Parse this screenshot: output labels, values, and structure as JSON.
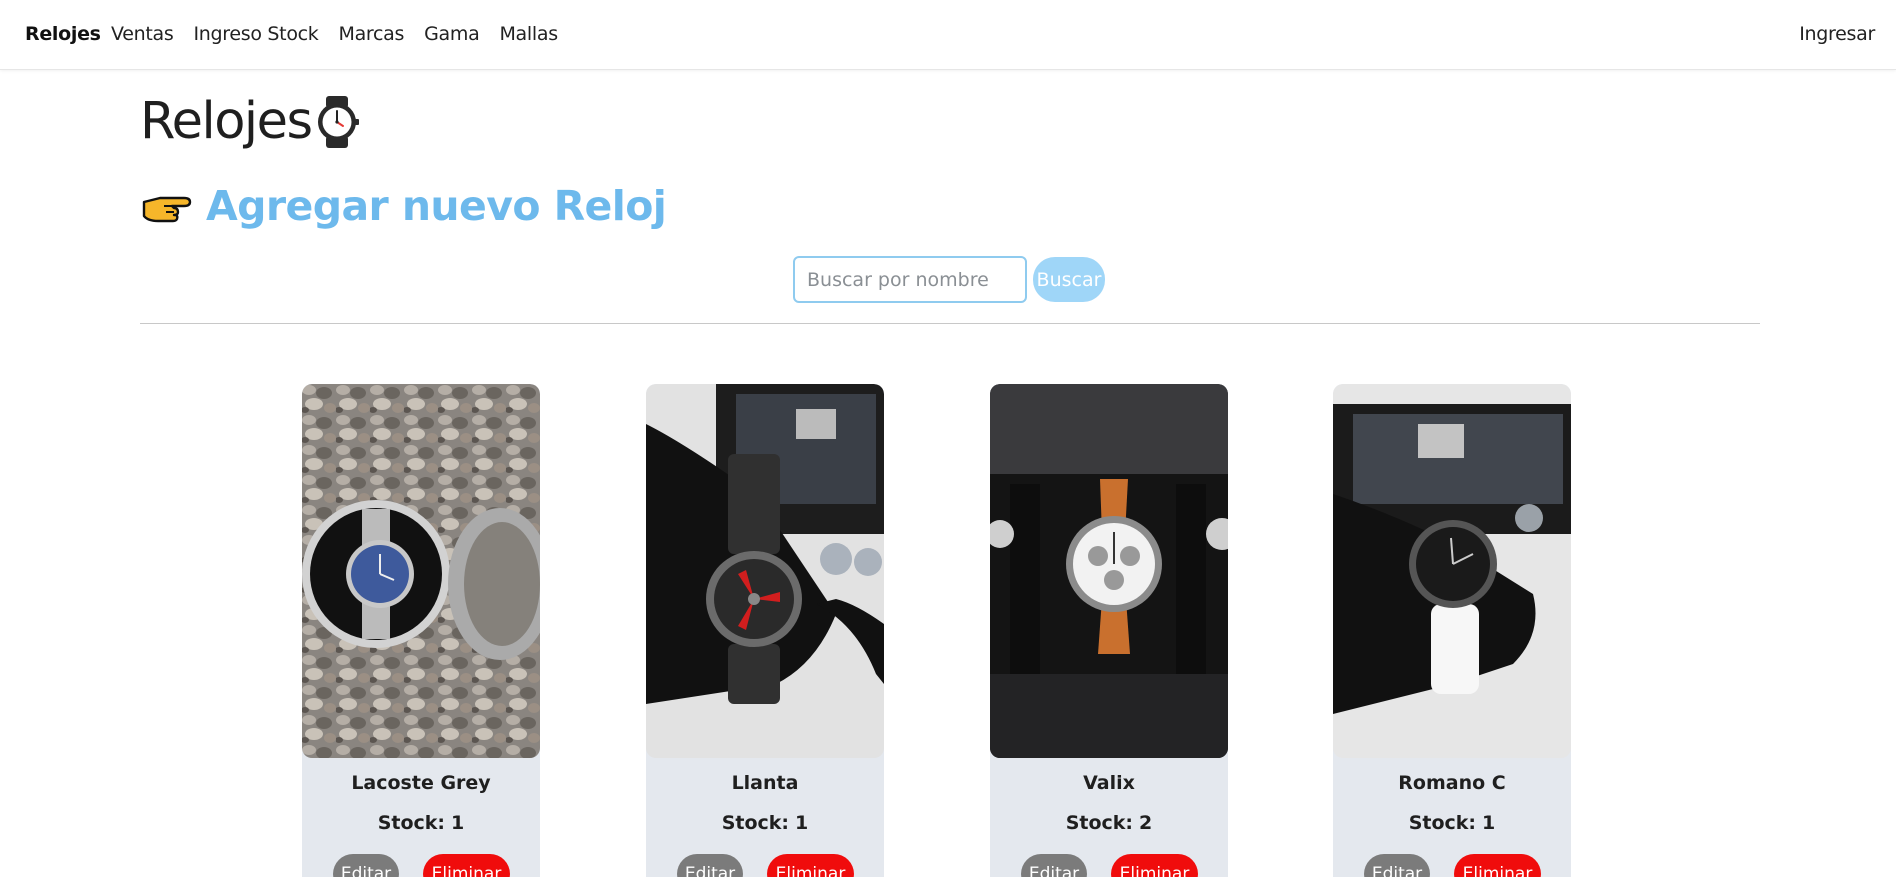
{
  "nav": {
    "brand": "Relojes",
    "links": [
      "Ventas",
      "Ingreso Stock",
      "Marcas",
      "Gama",
      "Mallas"
    ],
    "login": "Ingresar"
  },
  "page": {
    "title": "Relojes",
    "title_icon": "wristwatch-icon",
    "add_icon": "pointing-hand-icon",
    "add_link": "Agregar nuevo Reloj"
  },
  "search": {
    "placeholder": "Buscar por nombre",
    "value": "",
    "button": "Buscar"
  },
  "products": [
    {
      "name": "Lacoste Grey",
      "stock_label": "Stock:",
      "stock": "1",
      "edit": "Editar",
      "delete": "Eliminar"
    },
    {
      "name": "Llanta",
      "stock_label": "Stock:",
      "stock": "1",
      "edit": "Editar",
      "delete": "Eliminar"
    },
    {
      "name": "Valix",
      "stock_label": "Stock:",
      "stock": "2",
      "edit": "Editar",
      "delete": "Eliminar"
    },
    {
      "name": "Romano C",
      "stock_label": "Stock:",
      "stock": "1",
      "edit": "Editar",
      "delete": "Eliminar"
    }
  ],
  "colors": {
    "accent": "#6db9ec",
    "search_border": "#8fcbef",
    "search_button": "#9fd6f8",
    "edit_button": "#7b7b7b",
    "delete_button": "#f00c0c",
    "card_bg": "#e4e8ee"
  }
}
